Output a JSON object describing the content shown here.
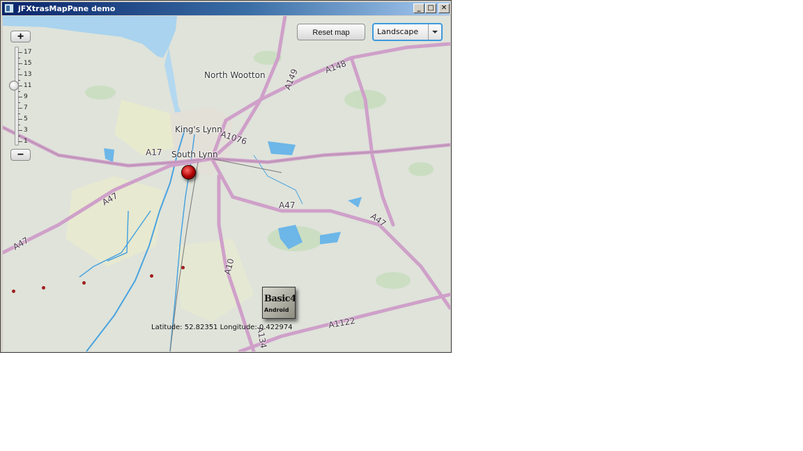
{
  "window": {
    "title": "jFXtrasMapPane demo",
    "controls": {
      "minimize": "_",
      "maximize": "□",
      "close": "✕"
    }
  },
  "toolbar": {
    "reset_label": "Reset map",
    "map_type": {
      "selected": "Landscape"
    }
  },
  "zoom": {
    "in_label": "+",
    "out_label": "−",
    "ticks": [
      "17",
      "15",
      "13",
      "11",
      "9",
      "7",
      "5",
      "3",
      "1"
    ],
    "current_level": 11
  },
  "map": {
    "places": {
      "north_wootton": "North Wootton",
      "kings_lynn": "King's Lynn",
      "south_lynn": "South Lynn"
    },
    "roads": {
      "a149": "A149",
      "a148": "A148",
      "a1076": "A1076",
      "a17": "A17",
      "a47_a": "A47",
      "a47_b": "A47",
      "a47_c": "A47",
      "a47_d": "A47",
      "a10": "A10",
      "a1122": "A1122",
      "a134": "A134"
    },
    "coordinates": "Latitude: 52.82351 Longitude: 0.422974"
  },
  "logo": {
    "line1": "Basic4",
    "line2": "Android"
  },
  "colors": {
    "road": "#cfa0c9",
    "water": "#4aa3df",
    "land": "#dfe3da",
    "sea": "#a9d3ee"
  }
}
